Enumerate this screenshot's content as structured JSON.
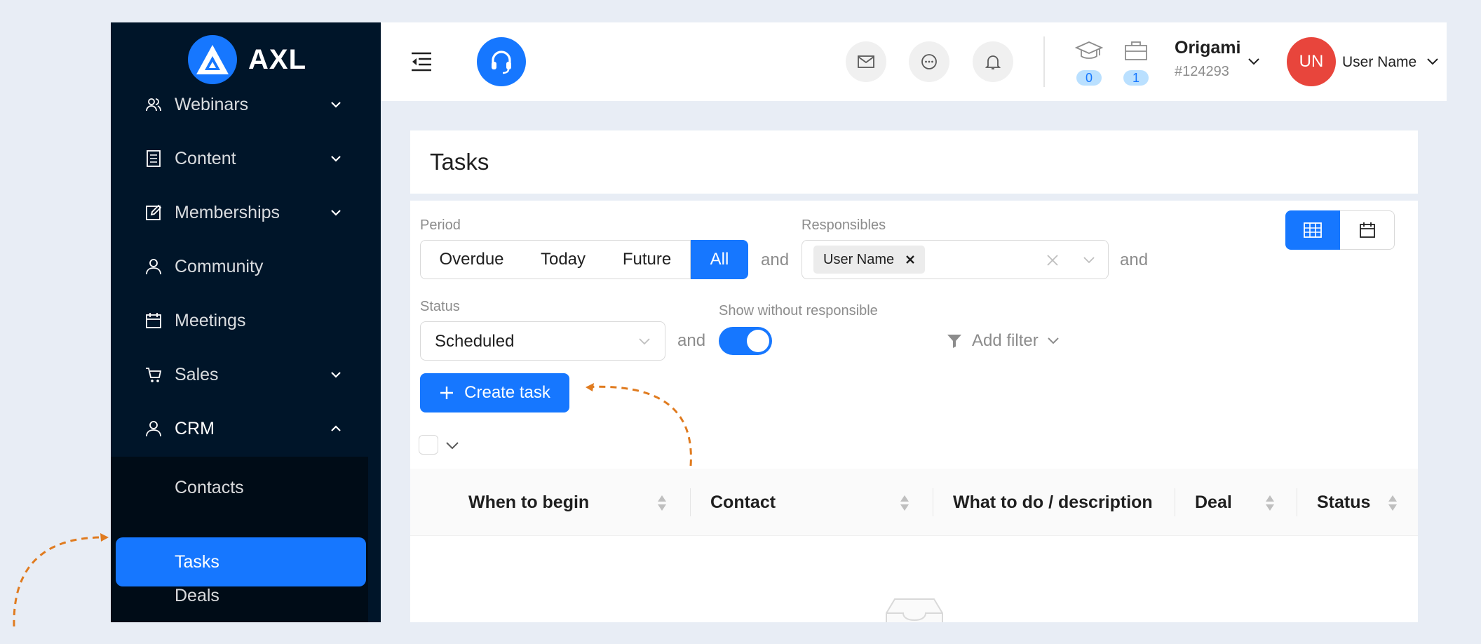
{
  "sidebar": {
    "logo_text": "AXL",
    "items": [
      {
        "label": "Webinars",
        "icon": "users-icon",
        "expandable": true
      },
      {
        "label": "Content",
        "icon": "document-icon",
        "expandable": true
      },
      {
        "label": "Memberships",
        "icon": "edit-icon",
        "expandable": true
      },
      {
        "label": "Community",
        "icon": "user-icon",
        "expandable": false
      },
      {
        "label": "Meetings",
        "icon": "calendar-icon",
        "expandable": false
      },
      {
        "label": "Sales",
        "icon": "cart-icon",
        "expandable": true
      },
      {
        "label": "CRM",
        "icon": "user-icon",
        "expandable": true,
        "open": true
      }
    ],
    "crm_sub": [
      {
        "label": "Contacts"
      },
      {
        "label": "Tasks",
        "active": true
      },
      {
        "label": "Deals"
      }
    ]
  },
  "header": {
    "badges": {
      "courses": "0",
      "products": "1"
    },
    "account": {
      "name": "Origami",
      "id": "#124293"
    },
    "user": {
      "initials": "UN",
      "name": "User Name"
    }
  },
  "page": {
    "title": "Tasks",
    "period_label": "Period",
    "period_options": [
      "Overdue",
      "Today",
      "Future",
      "All"
    ],
    "period_selected": "All",
    "and_text": "and",
    "responsibles_label": "Responsibles",
    "responsible_tag": "User Name",
    "status_label": "Status",
    "status_value": "Scheduled",
    "show_without_label": "Show without responsible",
    "show_without_on": true,
    "add_filter": "Add filter",
    "create_task": "Create task",
    "table": {
      "columns": [
        "When to begin",
        "Contact",
        "What to do / description",
        "Deal",
        "Status"
      ]
    }
  },
  "colors": {
    "primary": "#1677ff",
    "sidebar_bg": "#001529",
    "avatar": "#e8453c",
    "annotation": "#e07b1f"
  }
}
